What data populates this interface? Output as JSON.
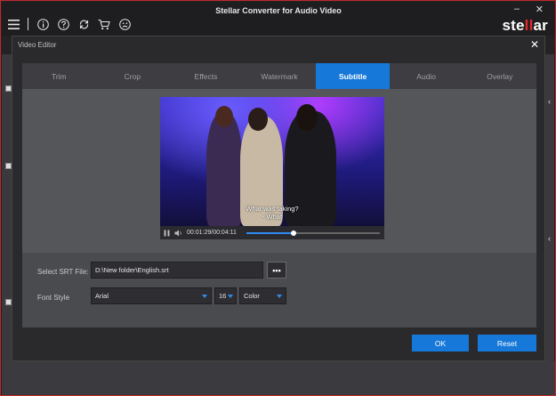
{
  "app": {
    "title": "Stellar Converter for Audio Video",
    "logo_prefix": "ste",
    "logo_mid": "ll",
    "logo_suffix": "ar",
    "minimize": "–",
    "close": "✕"
  },
  "toolbar_icons": [
    "menu-icon",
    "info-icon",
    "help-icon",
    "refresh-icon",
    "cart-icon",
    "account-icon"
  ],
  "dialog": {
    "title": "Video Editor",
    "close": "✕"
  },
  "tabs": [
    {
      "label": "Trim",
      "active": false
    },
    {
      "label": "Crop",
      "active": false
    },
    {
      "label": "Effects",
      "active": false
    },
    {
      "label": "Watermark",
      "active": false
    },
    {
      "label": "Subtitle",
      "active": true
    },
    {
      "label": "Audio",
      "active": false
    },
    {
      "label": "Overlay",
      "active": false
    }
  ],
  "player": {
    "subtitle_line1": "What was faking?",
    "subtitle_line2": "- What",
    "time": "00:01:29/00:04:11",
    "progress_fraction": 0.35
  },
  "form": {
    "srt_label": "Select SRT File:",
    "srt_value": "D:\\New folder\\English.srt",
    "browse_label": "•••",
    "font_style_label": "Font Style",
    "font_value": "Arial",
    "size_value": "16",
    "color_value": "Color"
  },
  "buttons": {
    "ok": "OK",
    "reset": "Reset"
  },
  "colors": {
    "accent": "#1678d8",
    "brand_red": "#e0282e"
  }
}
